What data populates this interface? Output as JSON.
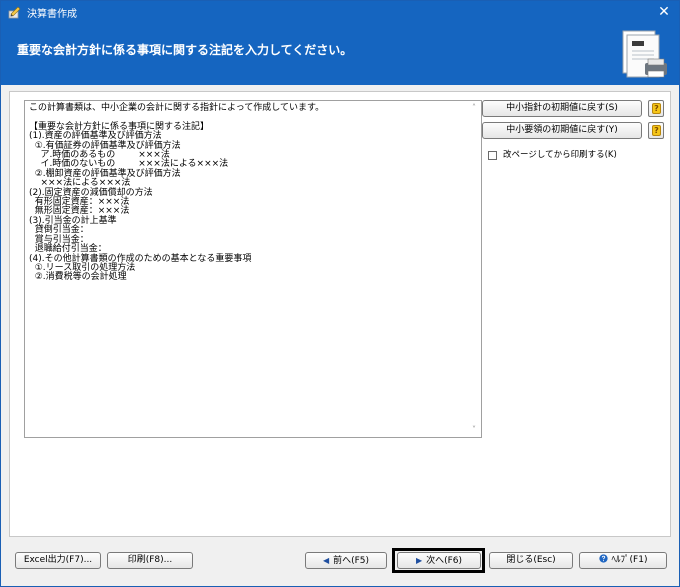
{
  "window": {
    "title": "決算書作成",
    "close_glyph": "✕",
    "icon": "app-pencil-icon"
  },
  "header": {
    "instruction": "重要な会計方針に係る事項に関する注記を入力してください。",
    "art": "document-printer-icon"
  },
  "note_text": {
    "lines": [
      "この計算書類は、中小企業の会計に関する指針によって作成しています。",
      "",
      "【重要な会計方針に係る事項に関する注記】",
      "(1).資産の評価基準及び評価方法",
      "  ①.有価証券の評価基準及び評価方法",
      "    ア.時価のあるもの        ×××法",
      "    イ.時価のないもの        ×××法による×××法",
      "  ②.棚卸資産の評価基準及び評価方法",
      "    ×××法による×××法",
      "(2).固定資産の減価償却の方法",
      "  有形固定資産：×××法",
      "  無形固定資産：×××法",
      "(3).引当金の計上基準",
      "  貸倒引当金：",
      "  賞与引当金：",
      "  退職給付引当金：",
      "(4).その他計算書類の作成のための基本となる重要事項",
      "  ①.リース取引の処理方法",
      "  ②.消費税等の会計処理"
    ],
    "scroll_up": "˄",
    "scroll_down": "˅"
  },
  "side": {
    "reset_sme_guidelines": "中小指針の初期値に戻す(S)",
    "reset_sme_essentials": "中小要領の初期値に戻す(Y)",
    "help_glyph": "?",
    "page_break_label": "改ページしてから印刷する(K)",
    "page_break_checked": false
  },
  "footer": {
    "excel": "Excel出力(F7)...",
    "print": "印刷(F8)...",
    "back": "前へ(F5)",
    "back_glyph": "◀",
    "next": "次へ(F6)",
    "next_glyph": "▶",
    "close": "閉じる(Esc)",
    "help": "ﾍﾙﾌﾟ(F1)",
    "help_icon": "question-circle-icon"
  },
  "colors": {
    "titlebar": "#1565c0",
    "header": "#1565c0",
    "help_badge": "#f5c518"
  }
}
